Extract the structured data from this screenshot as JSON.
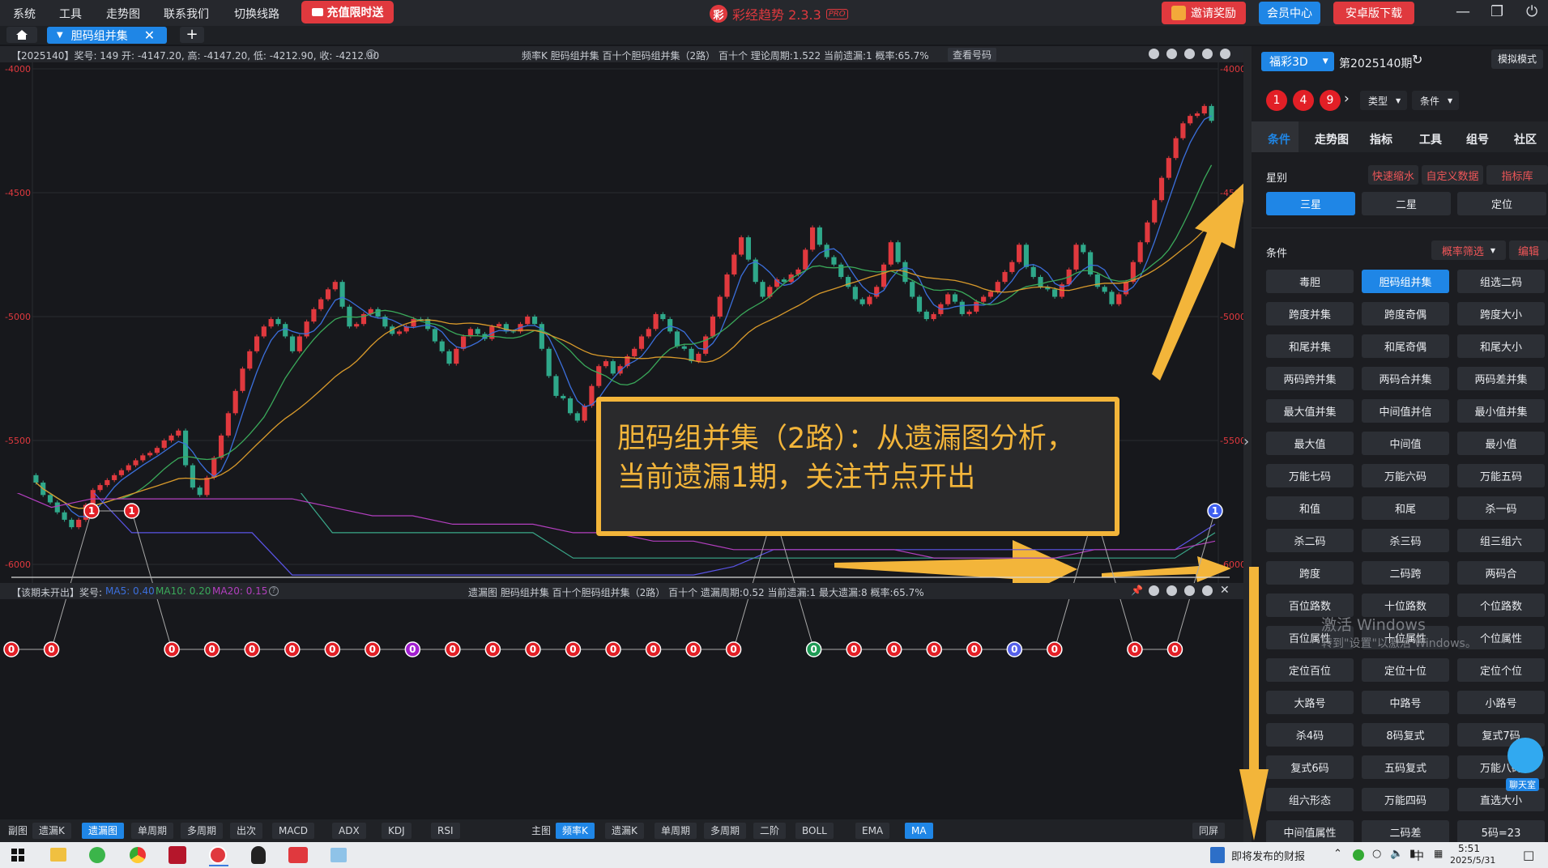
{
  "menu": {
    "items": [
      "系统",
      "工具",
      "走势图",
      "联系我们",
      "切换线路"
    ],
    "recharge": "充值限时送"
  },
  "app": {
    "logo_char": "彩",
    "title": "彩经趋势 2.3.3",
    "badge": "PRO"
  },
  "header_buttons": {
    "invite": "邀请奖励",
    "member": "会员中心",
    "android": "安卓版下载"
  },
  "tabs": {
    "active": "胆码组并集",
    "add": "+"
  },
  "chart_info": {
    "left": "【2025140】奖号: 149  开: -4147.20, 高: -4147.20, 低: -4212.90, 收: -4212.90",
    "right": "频率K   胆码组并集   百十个胆码组并集（2路）   百十个   理论周期:1.522   当前遗漏:1   概率:65.7%",
    "button": "查看号码"
  },
  "sub_info": {
    "left_prefix": "【该期未开出】奖号:",
    "ma5": "MA5: 0.40",
    "ma10": "MA10: 0.20",
    "ma20": "MA20: 0.15",
    "right": "遗漏图   胆码组并集   百十个胆码组并集（2路）   百十个   遗漏周期:0.52   当前遗漏:1   最大遗漏:8   概率:65.7%"
  },
  "callout": {
    "line1": "胆码组并集（2路）：从遗漏图分析，",
    "line2": "当前遗漏1期，关注节点开出"
  },
  "chart_data": {
    "type": "line",
    "title": "",
    "y_ticks": [
      "-4000",
      "-4500",
      "-5000",
      "-5500",
      "-6000"
    ],
    "ylim": [
      -6000,
      -4000
    ],
    "candles_close": [
      -5670,
      -5720,
      -5750,
      -5790,
      -5820,
      -5850,
      -5820,
      -5760,
      -5700,
      -5680,
      -5660,
      -5640,
      -5620,
      -5600,
      -5580,
      -5560,
      -5550,
      -5530,
      -5500,
      -5480,
      -5460,
      -5600,
      -5690,
      -5720,
      -5650,
      -5570,
      -5480,
      -5390,
      -5300,
      -5210,
      -5140,
      -5080,
      -5040,
      -5010,
      -5030,
      -5080,
      -5140,
      -5080,
      -5020,
      -4970,
      -4930,
      -4890,
      -4860,
      -4960,
      -5040,
      -5030,
      -4990,
      -4970,
      -5000,
      -5040,
      -5070,
      -5060,
      -5040,
      -5010,
      -5010,
      -5050,
      -5100,
      -5140,
      -5190,
      -5130,
      -5080,
      -5050,
      -5070,
      -5090,
      -5040,
      -5030,
      -5060,
      -5060,
      -5030,
      -5000,
      -5030,
      -5130,
      -5240,
      -5320,
      -5330,
      -5390,
      -5420,
      -5360,
      -5280,
      -5200,
      -5180,
      -5230,
      -5200,
      -5160,
      -5130,
      -5080,
      -5050,
      -4990,
      -5010,
      -5060,
      -5120,
      -5130,
      -5180,
      -5150,
      -5080,
      -5000,
      -4920,
      -4830,
      -4750,
      -4680,
      -4770,
      -4860,
      -4920,
      -4880,
      -4850,
      -4860,
      -4830,
      -4810,
      -4730,
      -4640,
      -4710,
      -4760,
      -4790,
      -4840,
      -4880,
      -4930,
      -4950,
      -4920,
      -4880,
      -4790,
      -4700,
      -4780,
      -4860,
      -4920,
      -4980,
      -5010,
      -4990,
      -4950,
      -4910,
      -4940,
      -4990,
      -4980,
      -4940,
      -4920,
      -4900,
      -4860,
      -4820,
      -4780,
      -4710,
      -4800,
      -4840,
      -4880,
      -4890,
      -4920,
      -4870,
      -4810,
      -4710,
      -4740,
      -4830,
      -4880,
      -4900,
      -4950,
      -4910,
      -4860,
      -4780,
      -4700,
      -4620,
      -4530,
      -4440,
      -4360,
      -4280,
      -4220,
      -4190,
      -4180,
      -4150,
      -4210
    ],
    "ma_series": [
      {
        "color": "#3b6fdc"
      },
      {
        "color": "#3aa95a"
      },
      {
        "color": "#d99a2b"
      }
    ],
    "sub_series_colors": [
      "#5a54e6",
      "#3aa98a",
      "#b33fbf",
      "#cfcfcf"
    ],
    "omission_nodes": [
      {
        "label": "0",
        "color": "#e21f26"
      },
      {
        "label": "0",
        "color": "#e21f26"
      },
      {
        "label": "1",
        "color": "#e21f26",
        "peak": true
      },
      {
        "label": "1",
        "color": "#e21f26",
        "peak": true
      },
      {
        "label": "0",
        "color": "#e21f26"
      },
      {
        "label": "0",
        "color": "#e21f26"
      },
      {
        "label": "0",
        "color": "#e21f26"
      },
      {
        "label": "0",
        "color": "#e21f26"
      },
      {
        "label": "0",
        "color": "#e21f26"
      },
      {
        "label": "0",
        "color": "#e21f26"
      },
      {
        "label": "0",
        "color": "#a21fd0"
      },
      {
        "label": "0",
        "color": "#e21f26"
      },
      {
        "label": "0",
        "color": "#e21f26"
      },
      {
        "label": "0",
        "color": "#e21f26"
      },
      {
        "label": "0",
        "color": "#e21f26"
      },
      {
        "label": "0",
        "color": "#e21f26"
      },
      {
        "label": "0",
        "color": "#e21f26"
      },
      {
        "label": "0",
        "color": "#e21f26"
      },
      {
        "label": "0",
        "color": "#e21f26"
      },
      {
        "label": "1",
        "color": "#e21f26",
        "peak": true
      },
      {
        "label": "0",
        "color": "#1f9a55"
      },
      {
        "label": "0",
        "color": "#e21f26"
      },
      {
        "label": "0",
        "color": "#e21f26"
      },
      {
        "label": "0",
        "color": "#e21f26"
      },
      {
        "label": "0",
        "color": "#e21f26"
      },
      {
        "label": "0",
        "color": "#5560e8"
      },
      {
        "label": "0",
        "color": "#e21f26"
      },
      {
        "label": "1",
        "color": "#e21f26",
        "peak": true
      },
      {
        "label": "0",
        "color": "#e21f26"
      },
      {
        "label": "0",
        "color": "#e21f26"
      },
      {
        "label": "1",
        "color": "#3f5ff0",
        "peak": true
      }
    ]
  },
  "bottombar": {
    "left_label": "副图",
    "left_buttons": [
      "遗漏K",
      "遗漏图",
      "单周期",
      "多周期",
      "出次",
      "MACD",
      "ADX",
      "KDJ",
      "RSI"
    ],
    "mid_label": "主图",
    "mid_buttons": [
      "频率K",
      "遗漏K",
      "单周期",
      "多周期",
      "二阶",
      "BOLL",
      "EMA",
      "MA"
    ],
    "right_button": "同屏"
  },
  "panel": {
    "lottery": "福彩3D",
    "issue": "第2025140期",
    "mode": "模拟模式",
    "balls": [
      "1",
      "4",
      "9"
    ],
    "type_dd": "类型",
    "cond_dd": "条件",
    "tabs": [
      "条件",
      "走势图",
      "指标",
      "工具",
      "组号",
      "社区"
    ],
    "star_label": "星别",
    "star_links": [
      "快速缩水",
      "自定义数据",
      "指标库"
    ],
    "stars": [
      "三星",
      "二星",
      "定位"
    ],
    "cond_label": "条件",
    "prob_filter": "概率筛选",
    "edit": "编辑",
    "conditions": [
      "毒胆",
      "胆码组并集",
      "组选二码",
      "跨度并集",
      "跨度奇偶",
      "跨度大小",
      "和尾并集",
      "和尾奇偶",
      "和尾大小",
      "两码跨并集",
      "两码合并集",
      "两码差并集",
      "最大值并集",
      "中间值并信",
      "最小值并集",
      "最大值",
      "中间值",
      "最小值",
      "万能七码",
      "万能六码",
      "万能五码",
      "和值",
      "和尾",
      "杀一码",
      "杀二码",
      "杀三码",
      "组三组六",
      "跨度",
      "二码跨",
      "两码合",
      "百位路数",
      "十位路数",
      "个位路数",
      "百位属性",
      "十位属性",
      "个位属性",
      "定位百位",
      "定位十位",
      "定位个位",
      "大路号",
      "中路号",
      "小路号",
      "杀4码",
      "8码复式",
      "复式7码",
      "复式6码",
      "五码复式",
      "万能八码",
      "组六形态",
      "万能四码",
      "直选大小",
      "中间值属性",
      "二码差",
      "5码=23"
    ]
  },
  "watermark": {
    "line1": "激活 Windows",
    "line2": "转到\"设置\"以激活 Windows。"
  },
  "chat_label": "聊天室",
  "taskbar": {
    "news": "即将发布的财报",
    "ime": "中",
    "time": "5:51",
    "date": "2025/5/31"
  }
}
